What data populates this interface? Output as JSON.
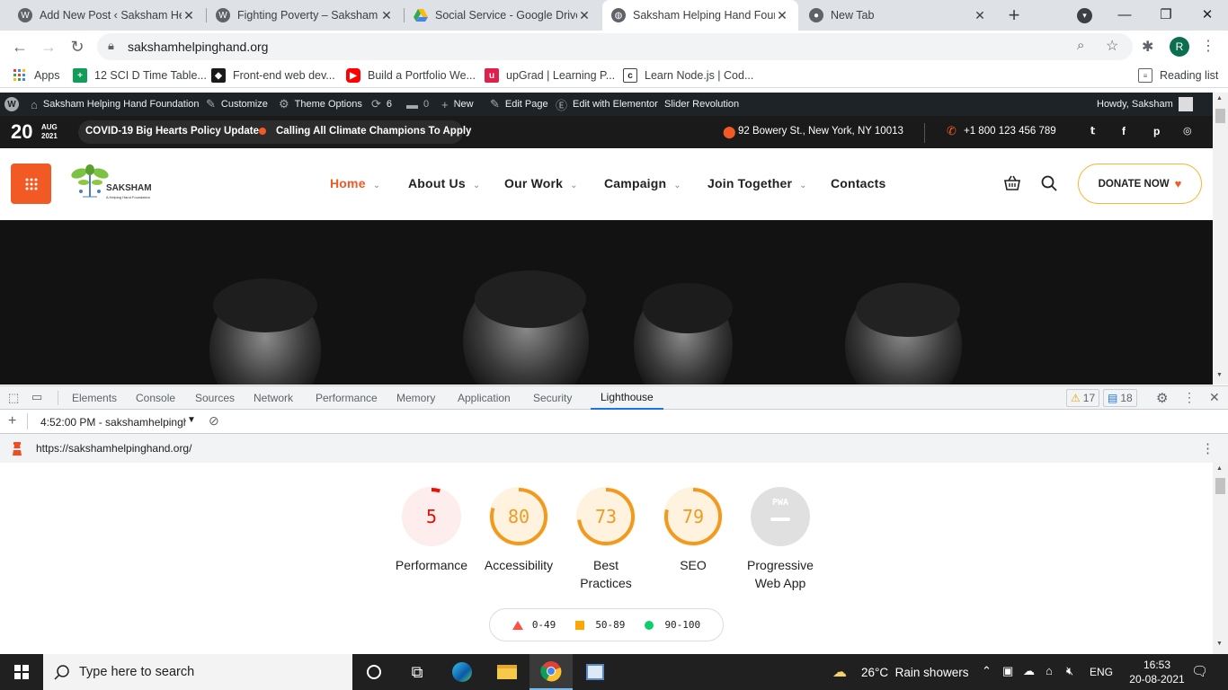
{
  "browser": {
    "tabs": [
      {
        "title": "Add New Post ‹ Saksham Hel",
        "icon": "wordpress-icon",
        "active": false
      },
      {
        "title": "Fighting Poverty – Saksham H",
        "icon": "wordpress-icon",
        "active": false
      },
      {
        "title": "Social Service - Google Drive",
        "icon": "google-drive-icon",
        "active": false
      },
      {
        "title": "Saksham Helping Hand Foun",
        "icon": "globe-icon",
        "active": true
      },
      {
        "title": "New Tab",
        "icon": "chrome-icon",
        "active": false
      }
    ],
    "new_tab_symbol": "+",
    "url": "sakshamhelpinghand.org",
    "profile_initial": "R",
    "bookmarks": [
      {
        "label": "Apps",
        "icon": "apps-grid-icon"
      },
      {
        "label": "12 SCI D Time Table...",
        "icon": "sheets-icon"
      },
      {
        "label": "Front-end web dev...",
        "icon": "bookmark-icon"
      },
      {
        "label": "Build a Portfolio We...",
        "icon": "youtube-icon"
      },
      {
        "label": "upGrad | Learning P...",
        "icon": "upgrad-icon"
      },
      {
        "label": "Learn Node.js | Cod...",
        "icon": "codecademy-icon"
      }
    ],
    "reading_list": "Reading list"
  },
  "wp_admin_bar": {
    "site_name": "Saksham Helping Hand Foundation",
    "customize": "Customize",
    "theme_options": "Theme Options",
    "updates": "6",
    "comments": "0",
    "new": "New",
    "edit_page": "Edit Page",
    "edit_elementor": "Edit with Elementor",
    "slider_revolution": "Slider Revolution",
    "howdy": "Howdy, Saksham"
  },
  "site_topbar": {
    "day": "20",
    "month": "AUG",
    "year": "2021",
    "news1": "COVID-19 Big Hearts Policy Update",
    "news2": "Calling All Climate Champions To Apply",
    "address": "92 Bowery St., New York, NY 10013",
    "phone": "+1 800 123 456 789",
    "social": [
      "twitter-icon",
      "facebook-icon",
      "pinterest-icon",
      "instagram-icon"
    ]
  },
  "site_header": {
    "logo_name": "SAKSHAM",
    "logo_tagline": "A Helping Hand Foundation",
    "nav": [
      {
        "label": "Home",
        "dropdown": true,
        "active": true
      },
      {
        "label": "About Us",
        "dropdown": true,
        "active": false
      },
      {
        "label": "Our Work",
        "dropdown": true,
        "active": false
      },
      {
        "label": "Campaign",
        "dropdown": true,
        "active": false
      },
      {
        "label": "Join Together",
        "dropdown": true,
        "active": false
      },
      {
        "label": "Contacts",
        "dropdown": false,
        "active": false
      }
    ],
    "donate_label": "DONATE NOW",
    "accent_color": "#f15a24"
  },
  "devtools": {
    "tabs": [
      "Elements",
      "Console",
      "Sources",
      "Network",
      "Performance",
      "Memory",
      "Application",
      "Security",
      "Lighthouse"
    ],
    "active_tab": "Lighthouse",
    "warnings": "17",
    "messages": "18",
    "report_selector": "4:52:00 PM - sakshamhelpingh",
    "report_url": "https://sakshamhelpinghand.org/"
  },
  "lighthouse": {
    "scores": [
      {
        "label": "Performance",
        "value": 5,
        "display": "5",
        "color": "#eb0f00",
        "bg": "#fdeded"
      },
      {
        "label": "Accessibility",
        "value": 80,
        "display": "80",
        "color": "#f09a20",
        "bg": "#fff3e0"
      },
      {
        "label": "Best Practices",
        "value": 73,
        "display": "73",
        "color": "#f09a20",
        "bg": "#fff3e0"
      },
      {
        "label": "SEO",
        "value": 79,
        "display": "79",
        "color": "#f09a20",
        "bg": "#fff3e0"
      },
      {
        "label": "Progressive Web App",
        "value": null,
        "display": "PWA",
        "color": "#9e9e9e",
        "bg": "#e0e0e0"
      }
    ],
    "legend": [
      {
        "range": "0-49",
        "color": "#ff4e42",
        "shape": "triangle"
      },
      {
        "range": "50-89",
        "color": "#ffa400",
        "shape": "square"
      },
      {
        "range": "90-100",
        "color": "#0cce6b",
        "shape": "circle"
      }
    ]
  },
  "taskbar": {
    "search_placeholder": "Type here to search",
    "weather": "26°C  Rain showers",
    "language": "ENG",
    "time": "16:53",
    "date": "20-08-2021"
  }
}
